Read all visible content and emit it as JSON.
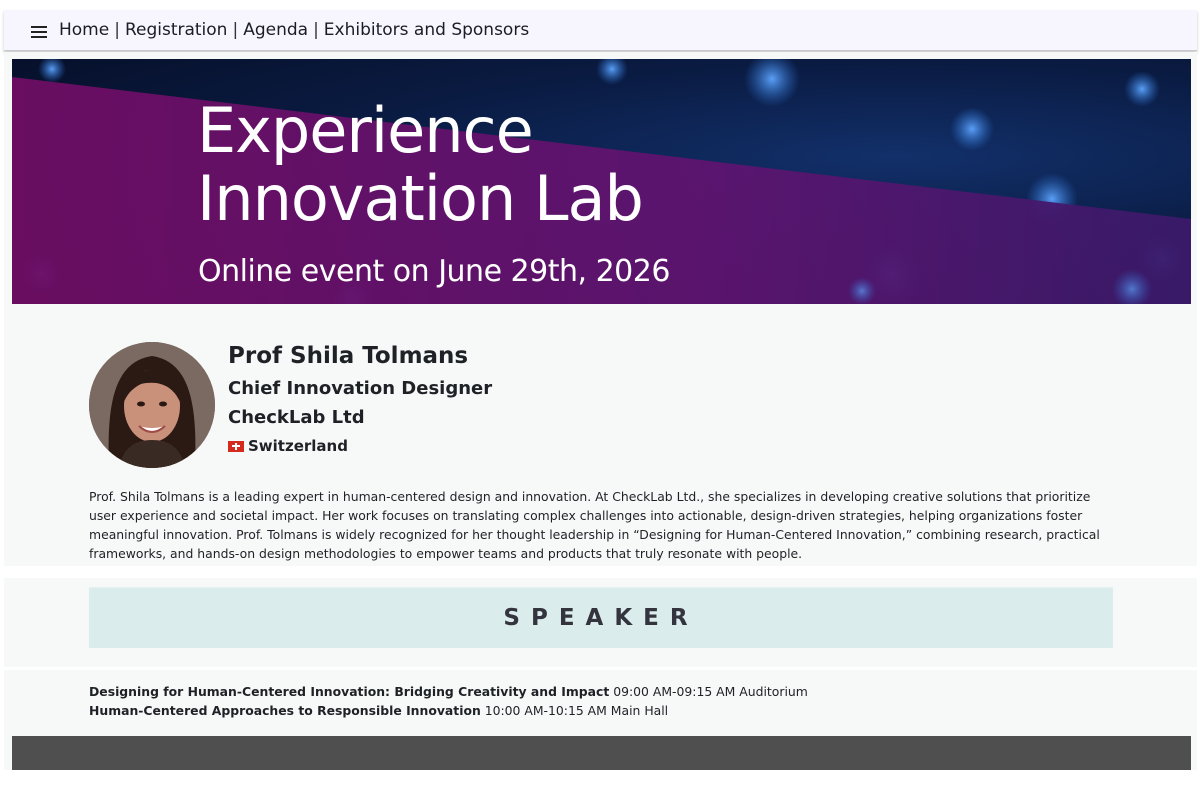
{
  "nav": {
    "menu_icon": "hamburger-menu-icon",
    "items": [
      "Home",
      "Registration",
      "Agenda",
      "Exhibitors and Sponsors"
    ],
    "separator": "|"
  },
  "banner": {
    "title_line1": "Experience",
    "title_line2": "Innovation Lab",
    "subtitle": "Online event on June 29th, 2026",
    "colors": {
      "purple": "#7a0f6e",
      "navy": "#071437",
      "glow": "#3f8be0"
    }
  },
  "speaker": {
    "name": "Prof Shila Tolmans",
    "title": "Chief Innovation Designer",
    "company": "CheckLab Ltd",
    "country": "Switzerland",
    "flag_icon": "switzerland-flag-icon",
    "bio": "Prof. Shila Tolmans is a leading expert in human-centered design and innovation. At CheckLab Ltd., she specializes in developing creative solutions that prioritize user experience and societal impact. Her work focuses on translating complex challenges into actionable, design-driven strategies, helping organizations foster meaningful innovation. Prof. Tolmans is widely recognized for her thought leadership in “Designing for Human-Centered Innovation,” combining research, practical frameworks, and hands-on design methodologies to empower teams and products that truly resonate with people."
  },
  "section_label": "SPEAKER",
  "sessions": [
    {
      "title": "Designing for Human-Centered Innovation: Bridging Creativity and Impact",
      "time": "09:00 AM-09:15 AM",
      "room": "Auditorium"
    },
    {
      "title": "Human-Centered Approaches to Responsible Innovation",
      "time": "10:00 AM-10:15 AM",
      "room": "Main Hall"
    }
  ],
  "colors": {
    "speaker_bar": "#daecec",
    "footer": "#4f4f4f",
    "nav_bg": "#f7f6fe"
  }
}
